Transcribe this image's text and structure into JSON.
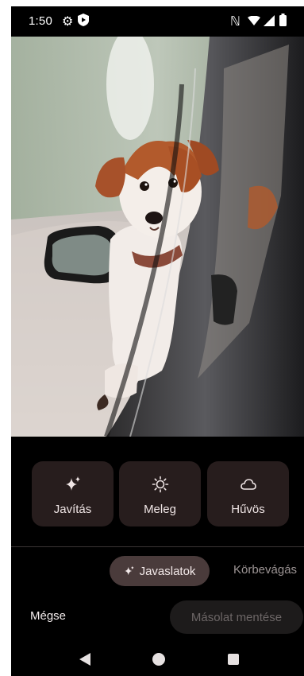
{
  "status_bar": {
    "time": "1:50",
    "icons": [
      "settings-icon",
      "shield-icon",
      "nfc-icon",
      "wifi-icon",
      "signal-icon",
      "battery-icon"
    ],
    "nfc_glyph": "ℕ"
  },
  "photo": {
    "subject": "dog-looking-out-car-window"
  },
  "filters": [
    {
      "label": "Javítás",
      "icon": "sparkle-icon"
    },
    {
      "label": "Meleg",
      "icon": "sun-icon"
    },
    {
      "label": "Hűvös",
      "icon": "cloud-icon"
    }
  ],
  "tabs": {
    "active": {
      "label": "Javaslatok",
      "icon": "sparkle-icon"
    },
    "inactive": {
      "label": "Körbevágás"
    }
  },
  "actions": {
    "cancel_label": "Mégse",
    "save_copy_label": "Másolat mentése"
  },
  "navbar": {
    "icons": [
      "back-icon",
      "home-icon",
      "recents-icon"
    ]
  },
  "colors": {
    "background": "#000000",
    "chip": "#271d1d",
    "active_tab": "#4a3b3b",
    "disabled_button": "#1d1b1b"
  }
}
